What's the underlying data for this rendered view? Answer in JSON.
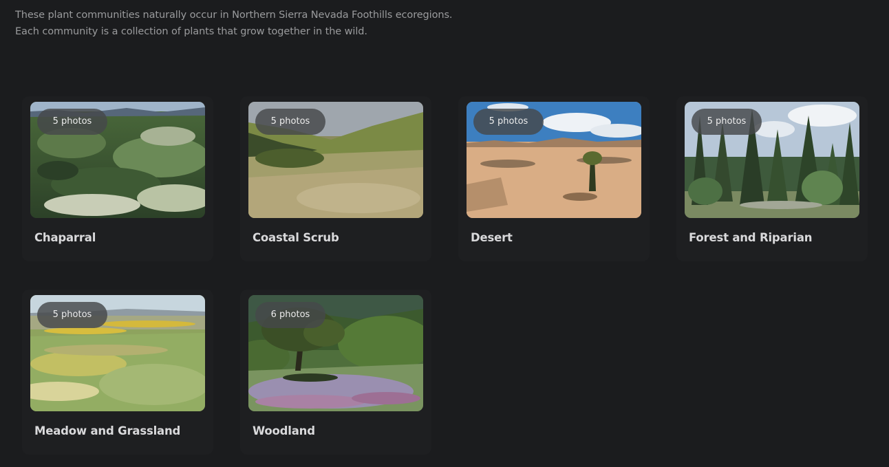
{
  "intro": {
    "line1": "These plant communities naturally occur in Northern Sierra Nevada Foothills ecoregions.",
    "line2": "Each community is a collection of plants that grow together in the wild."
  },
  "communities": [
    {
      "name": "Chaparral",
      "photos": "5 photos"
    },
    {
      "name": "Coastal Scrub",
      "photos": "5 photos"
    },
    {
      "name": "Desert",
      "photos": "5 photos"
    },
    {
      "name": "Forest and Riparian",
      "photos": "5 photos"
    },
    {
      "name": "Meadow and Grassland",
      "photos": "5 photos"
    },
    {
      "name": "Woodland",
      "photos": "6 photos"
    }
  ],
  "colors": {
    "background": "#1b1c1e",
    "card": "#1e1f21",
    "intro_text": "#9a9b9d",
    "title_text": "#d9d9db",
    "badge": "#46484a"
  }
}
